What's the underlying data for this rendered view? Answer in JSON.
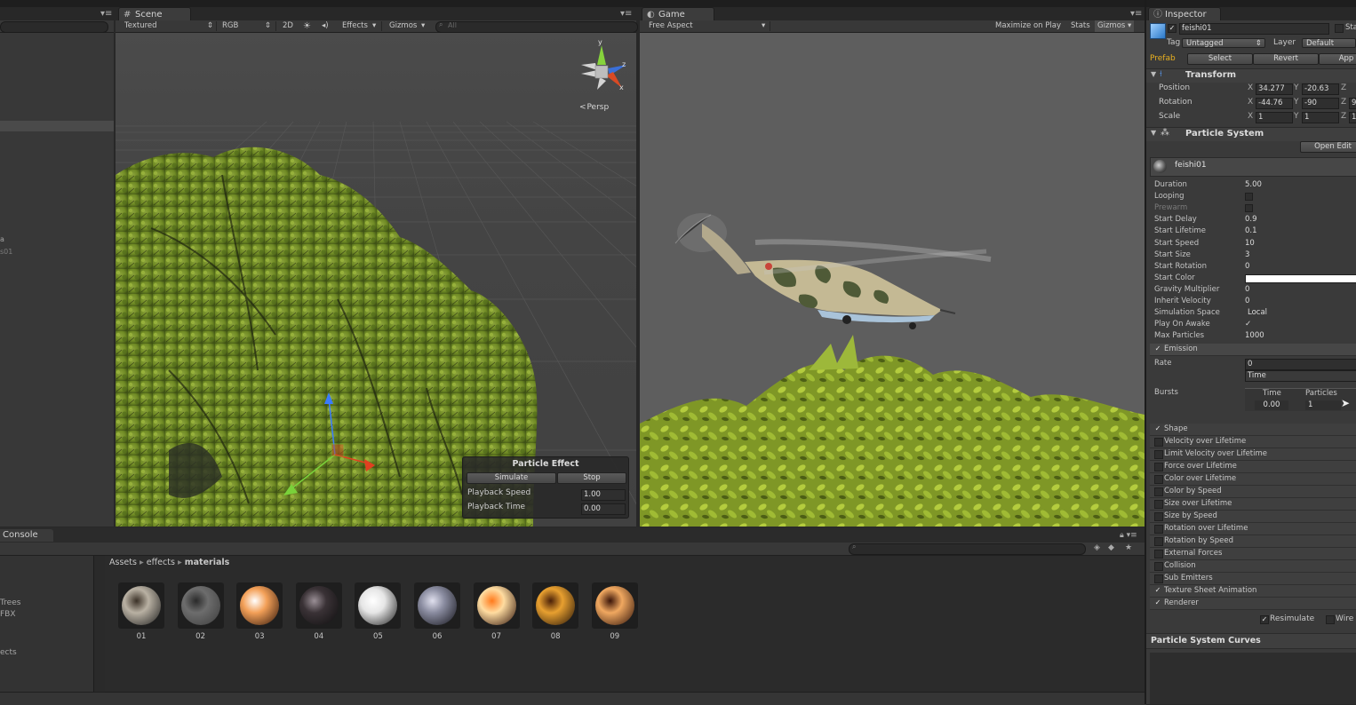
{
  "scene": {
    "tab": "Scene",
    "toolbar": {
      "shading": "Textured",
      "render_mode": "RGB",
      "twod": "2D",
      "effects": "Effects",
      "gizmos": "Gizmos",
      "search_placeholder": "All"
    },
    "gizmo_axes": {
      "y": "y",
      "x": "x",
      "z": "z"
    },
    "persp": "Persp"
  },
  "game": {
    "tab": "Game",
    "toolbar": {
      "aspect": "Free Aspect",
      "maximize": "Maximize on Play",
      "stats": "Stats",
      "gizmos": "Gizmos"
    }
  },
  "particle_effect": {
    "title": "Particle Effect",
    "simulate": "Simulate",
    "stop": "Stop",
    "playback_speed_label": "Playback Speed",
    "playback_speed": "1.00",
    "playback_time_label": "Playback Time",
    "playback_time": "0.00"
  },
  "hierarchy": {
    "items_partial": [
      "a",
      "s01"
    ]
  },
  "inspector": {
    "tab": "Inspector",
    "object_name": "feishi01",
    "static_label": "Sta",
    "tag_label": "Tag",
    "tag_value": "Untagged",
    "layer_label": "Layer",
    "layer_value": "Default",
    "prefab_label": "Prefab",
    "prefab_select": "Select",
    "prefab_revert": "Revert",
    "prefab_apply": "App",
    "transform": {
      "title": "Transform",
      "position_label": "Position",
      "pos_x": "34.277",
      "pos_y": "-20.63",
      "rotation_label": "Rotation",
      "rot_x": "-44.76",
      "rot_y": "-90",
      "rot_z": "9",
      "scale_label": "Scale",
      "scale_x": "1",
      "scale_y": "1",
      "scale_z": "1",
      "axis_x": "X",
      "axis_y": "Y",
      "axis_z": "Z"
    },
    "particle_system": {
      "title": "Particle System",
      "open_editor": "Open Edit",
      "system_name": "feishi01",
      "props": [
        {
          "label": "Duration",
          "value": "5.00"
        },
        {
          "label": "Looping",
          "value": ""
        },
        {
          "label": "Prewarm",
          "value": ""
        },
        {
          "label": "Start Delay",
          "value": "0.9"
        },
        {
          "label": "Start Lifetime",
          "value": "0.1"
        },
        {
          "label": "Start Speed",
          "value": "10"
        },
        {
          "label": "Start Size",
          "value": "3"
        },
        {
          "label": "Start Rotation",
          "value": "0"
        },
        {
          "label": "Start Color",
          "value": ""
        },
        {
          "label": "Gravity Multiplier",
          "value": "0"
        },
        {
          "label": "Inherit Velocity",
          "value": "0"
        },
        {
          "label": "Simulation Space",
          "value": "Local"
        },
        {
          "label": "Play On Awake",
          "value": "✓"
        },
        {
          "label": "Max Particles",
          "value": "1000"
        }
      ],
      "emission": {
        "title": "Emission",
        "rate_label": "Rate",
        "rate_value": "0",
        "rate_mode": "Time",
        "bursts_label": "Bursts",
        "bursts_time_header": "Time",
        "bursts_particles_header": "Particles",
        "burst_time": "0.00",
        "burst_particles": "1"
      },
      "modules": [
        {
          "label": "Shape",
          "checked": true
        },
        {
          "label": "Velocity over Lifetime",
          "checked": false
        },
        {
          "label": "Limit Velocity over Lifetime",
          "checked": false
        },
        {
          "label": "Force over Lifetime",
          "checked": false
        },
        {
          "label": "Color over Lifetime",
          "checked": false
        },
        {
          "label": "Color by Speed",
          "checked": false
        },
        {
          "label": "Size over Lifetime",
          "checked": false
        },
        {
          "label": "Size by Speed",
          "checked": false
        },
        {
          "label": "Rotation over Lifetime",
          "checked": false
        },
        {
          "label": "Rotation by Speed",
          "checked": false
        },
        {
          "label": "External Forces",
          "checked": false
        },
        {
          "label": "Collision",
          "checked": false
        },
        {
          "label": "Sub Emitters",
          "checked": false
        },
        {
          "label": "Texture Sheet Animation",
          "checked": true
        },
        {
          "label": "Renderer",
          "checked": true
        }
      ],
      "resimulate": "Resimulate",
      "wireframe": "Wire"
    },
    "curves_title": "Particle System Curves"
  },
  "console": {
    "tab": "Console"
  },
  "project": {
    "breadcrumb": [
      "Assets",
      "effects",
      "materials"
    ],
    "left_items": [
      "Trees",
      "FBX",
      "ects"
    ],
    "assets": [
      {
        "name": "01",
        "colors": [
          "#1c1c1c",
          "#b9b1a3",
          "#3a3026"
        ]
      },
      {
        "name": "02",
        "colors": [
          "#3b3b3b",
          "#6d6d6d",
          "#2a2a2a"
        ]
      },
      {
        "name": "03",
        "colors": [
          "#2a1208",
          "#f3a058",
          "#ffffff"
        ]
      },
      {
        "name": "04",
        "colors": [
          "#0e0e0e",
          "#3a3236",
          "#9a8f96"
        ]
      },
      {
        "name": "05",
        "colors": [
          "#1b1b1b",
          "#e6e6e6",
          "#ffffff"
        ]
      },
      {
        "name": "06",
        "colors": [
          "#121218",
          "#8a8ca0",
          "#e0e0ee"
        ]
      },
      {
        "name": "07",
        "colors": [
          "#2a0e06",
          "#ffdca0",
          "#ff7a1c"
        ]
      },
      {
        "name": "08",
        "colors": [
          "#201006",
          "#e8a030",
          "#4a2008"
        ]
      },
      {
        "name": "09",
        "colors": [
          "#2a0e06",
          "#f0a860",
          "#3a1408"
        ]
      }
    ]
  }
}
